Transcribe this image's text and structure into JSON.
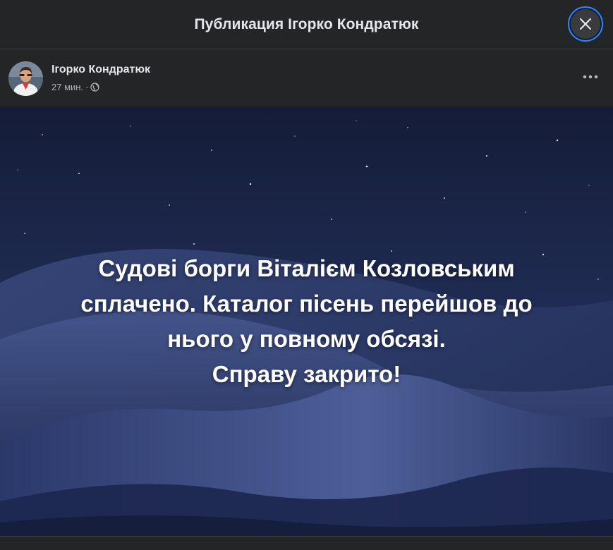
{
  "modal": {
    "title": "Публикация Ігорко Кондратюк",
    "close_icon": "close-icon"
  },
  "post": {
    "author": "Ігорко Кондратюк",
    "time": "27 мин.",
    "separator": "·",
    "privacy_icon": "globe-icon",
    "more_icon": "more-horizontal-icon",
    "text_lines": [
      "Судові борги Віталієм Козловським",
      "сплачено. Каталог пісень перейшов до",
      "нього у повному обсязі.",
      "Справу закрито!"
    ]
  },
  "colors": {
    "background": "#242526",
    "text_primary": "#e4e6eb",
    "text_secondary": "#b0b3b8",
    "focus_ring": "#2d88ff",
    "sky": "#1a2444"
  }
}
